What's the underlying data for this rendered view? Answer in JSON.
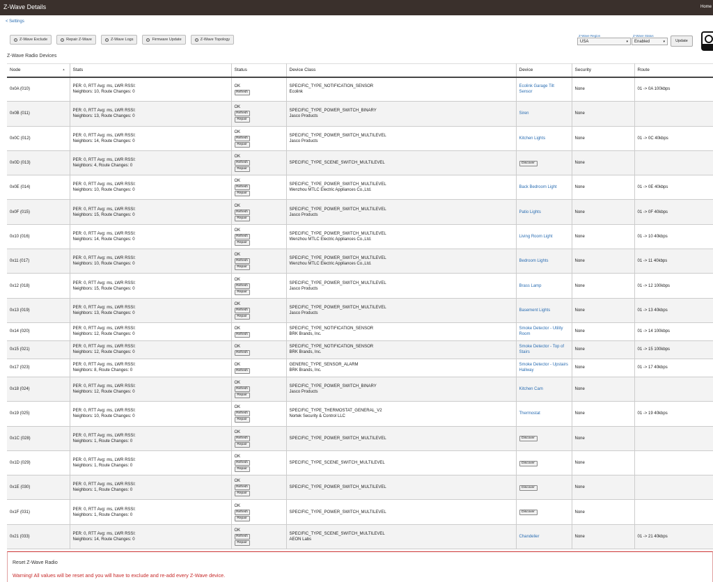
{
  "header": {
    "title": "Z-Wave Details",
    "home_label": "Home"
  },
  "breadcrumb": {
    "label": "< Settings"
  },
  "toolbar": {
    "buttons": [
      {
        "label": "Z-Wave Exclude",
        "icon": "zwave-icon"
      },
      {
        "label": "Repair Z-Wave",
        "icon": "zwave-icon"
      },
      {
        "label": "Z-Wave Logs",
        "icon": "list-icon"
      },
      {
        "label": "Firmware Update",
        "icon": "zwave-icon"
      },
      {
        "label": "Z-Wave Topology",
        "icon": "zwave-icon"
      }
    ]
  },
  "region": {
    "label": "Z-Wave Region",
    "value": "USA"
  },
  "status": {
    "label": "Z-Wave Status",
    "value": "Enabled"
  },
  "update_label": "Update",
  "section_title": "Z-Wave Radio Devices",
  "columns": [
    "Node",
    "Stats",
    "Status",
    "Device Class",
    "Device",
    "Security",
    "Route"
  ],
  "rows": [
    {
      "node": "0x0A (010)",
      "stats1": "PER: 0, RTT Avg: ms, LWR RSSI:",
      "stats2": "Neighbors: 10, Route Changes: 0",
      "status": "OK",
      "buttons": [
        "Refresh"
      ],
      "class1": "SPECIFIC_TYPE_NOTIFICATION_SENSOR",
      "class2": "Ecolink",
      "device": "Ecolink Garage Tilt Sensor",
      "security": "None",
      "route": "01 -> 0A 100kbps"
    },
    {
      "node": "0x0B (011)",
      "stats1": "PER: 0, RTT Avg: ms, LWR RSSI:",
      "stats2": "Neighbors: 13, Route Changes: 0",
      "status": "OK",
      "buttons": [
        "Refresh",
        "Repair"
      ],
      "class1": "SPECIFIC_TYPE_POWER_SWITCH_BINARY",
      "class2": "Jasco Products",
      "device": "Siren",
      "security": "None",
      "route": ""
    },
    {
      "node": "0x0C (012)",
      "stats1": "PER: 0, RTT Avg: ms, LWR RSSI:",
      "stats2": "Neighbors: 14, Route Changes: 0",
      "status": "OK",
      "buttons": [
        "Refresh",
        "Repair"
      ],
      "class1": "SPECIFIC_TYPE_POWER_SWITCH_MULTILEVEL",
      "class2": "Jasco Products",
      "device": "Kitchen Lights",
      "security": "None",
      "route": "01 -> 0C 40kbps"
    },
    {
      "node": "0x0D (013)",
      "stats1": "PER: 0, RTT Avg: ms, LWR RSSI:",
      "stats2": "Neighbors: 4, Route Changes: 0",
      "status": "OK",
      "buttons": [
        "Refresh",
        "Repair"
      ],
      "class1": "SPECIFIC_TYPE_SCENE_SWITCH_MULTILEVEL",
      "class2": "",
      "device": "",
      "discover": "Discover",
      "security": "None",
      "route": ""
    },
    {
      "node": "0x0E (014)",
      "stats1": "PER: 0, RTT Avg: ms, LWR RSSI:",
      "stats2": "Neighbors: 10, Route Changes: 0",
      "status": "OK",
      "buttons": [
        "Refresh",
        "Repair"
      ],
      "class1": "SPECIFIC_TYPE_POWER_SWITCH_MULTILEVEL",
      "class2": "Wenzhou MTLC Electric Appliances Co.,Ltd.",
      "device": "Back Bedroom Light",
      "security": "None",
      "route": "01 -> 0E 40kbps"
    },
    {
      "node": "0x0F (015)",
      "stats1": "PER: 0, RTT Avg: ms, LWR RSSI:",
      "stats2": "Neighbors: 15, Route Changes: 0",
      "status": "OK",
      "buttons": [
        "Refresh",
        "Repair"
      ],
      "class1": "SPECIFIC_TYPE_POWER_SWITCH_MULTILEVEL",
      "class2": "Jasco Products",
      "device": "Patio Lights",
      "security": "None",
      "route": "01 -> 0F 40kbps"
    },
    {
      "node": "0x10 (016)",
      "stats1": "PER: 0, RTT Avg: ms, LWR RSSI:",
      "stats2": "Neighbors: 14, Route Changes: 0",
      "status": "OK",
      "buttons": [
        "Refresh",
        "Repair"
      ],
      "class1": "SPECIFIC_TYPE_POWER_SWITCH_MULTILEVEL",
      "class2": "Wenzhou MTLC Electric Appliances Co.,Ltd.",
      "device": "Living Room Light",
      "security": "None",
      "route": "01 -> 10 40kbps"
    },
    {
      "node": "0x11 (017)",
      "stats1": "PER: 0, RTT Avg: ms, LWR RSSI:",
      "stats2": "Neighbors: 10, Route Changes: 0",
      "status": "OK",
      "buttons": [
        "Refresh",
        "Repair"
      ],
      "class1": "SPECIFIC_TYPE_POWER_SWITCH_MULTILEVEL",
      "class2": "Wenzhou MTLC Electric Appliances Co.,Ltd.",
      "device": "Bedroom Lights",
      "security": "None",
      "route": "01 -> 11 40kbps"
    },
    {
      "node": "0x12 (018)",
      "stats1": "PER: 0, RTT Avg: ms, LWR RSSI:",
      "stats2": "Neighbors: 15, Route Changes: 0",
      "status": "OK",
      "buttons": [
        "Refresh",
        "Repair"
      ],
      "class1": "SPECIFIC_TYPE_POWER_SWITCH_MULTILEVEL",
      "class2": "Jasco Products",
      "device": "Brass Lamp",
      "security": "None",
      "route": "01 -> 12 100kbps"
    },
    {
      "node": "0x13 (019)",
      "stats1": "PER: 0, RTT Avg: ms, LWR RSSI:",
      "stats2": "Neighbors: 13, Route Changes: 0",
      "status": "OK",
      "buttons": [
        "Refresh",
        "Repair"
      ],
      "class1": "SPECIFIC_TYPE_POWER_SWITCH_MULTILEVEL",
      "class2": "Jasco Products",
      "device": "Basement Lights",
      "security": "None",
      "route": "01 -> 13 40kbps"
    },
    {
      "node": "0x14 (020)",
      "short": true,
      "stats1": "PER: 0, RTT Avg: ms, LWR RSSI:",
      "stats2": "Neighbors: 12, Route Changes: 0",
      "status": "OK",
      "buttons": [
        "Refresh"
      ],
      "class1": "SPECIFIC_TYPE_NOTIFICATION_SENSOR",
      "class2": "BRK Brands, Inc.",
      "device": "Smoke Detector - Utility Room",
      "security": "None",
      "route": "01 -> 14 100kbps"
    },
    {
      "node": "0x15 (021)",
      "short": true,
      "stats1": "PER: 0, RTT Avg: ms, LWR RSSI:",
      "stats2": "Neighbors: 12, Route Changes: 0",
      "status": "OK",
      "buttons": [
        "Refresh"
      ],
      "class1": "SPECIFIC_TYPE_NOTIFICATION_SENSOR",
      "class2": "BRK Brands, Inc.",
      "device": "Smoke Detector - Top of Stairs",
      "security": "None",
      "route": "01 -> 15 100kbps"
    },
    {
      "node": "0x17 (023)",
      "short": true,
      "stats1": "PER: 0, RTT Avg: ms, LWR RSSI:",
      "stats2": "Neighbors: 8, Route Changes: 0",
      "status": "OK",
      "buttons": [
        "Refresh"
      ],
      "class1": "GENERIC_TYPE_SENSOR_ALARM",
      "class2": "BRK Brands, Inc.",
      "device": "Smoke Detector - Upstairs Hallway",
      "security": "None",
      "route": "01 -> 17 40kbps"
    },
    {
      "node": "0x18 (024)",
      "stats1": "PER: 0, RTT Avg: ms, LWR RSSI:",
      "stats2": "Neighbors: 12, Route Changes: 0",
      "status": "OK",
      "buttons": [
        "Refresh",
        "Repair"
      ],
      "class1": "SPECIFIC_TYPE_POWER_SWITCH_BINARY",
      "class2": "Jasco Products",
      "device": "Kitchen Cam",
      "security": "None",
      "route": ""
    },
    {
      "node": "0x19 (025)",
      "stats1": "PER: 0, RTT Avg: ms, LWR RSSI:",
      "stats2": "Neighbors: 10, Route Changes: 0",
      "status": "OK",
      "buttons": [
        "Refresh",
        "Repair"
      ],
      "class1": "SPECIFIC_TYPE_THERMOSTAT_GENERAL_V2",
      "class2": "Nortek Security & Control LLC",
      "device": "Thermostat",
      "security": "None",
      "route": "01 -> 19 40kbps"
    },
    {
      "node": "0x1C (028)",
      "stats1": "PER: 0, RTT Avg: ms, LWR RSSI:",
      "stats2": "Neighbors: 1, Route Changes: 0",
      "status": "OK",
      "buttons": [
        "Refresh",
        "Repair"
      ],
      "class1": "SPECIFIC_TYPE_POWER_SWITCH_MULTILEVEL",
      "class2": "",
      "device": "",
      "discover": "Discover",
      "security": "None",
      "route": ""
    },
    {
      "node": "0x1D (029)",
      "stats1": "PER: 0, RTT Avg: ms, LWR RSSI:",
      "stats2": "Neighbors: 1, Route Changes: 0",
      "status": "OK",
      "buttons": [
        "Refresh",
        "Repair"
      ],
      "class1": "SPECIFIC_TYPE_SCENE_SWITCH_MULTILEVEL",
      "class2": "",
      "device": "",
      "discover": "Discover",
      "security": "None",
      "route": ""
    },
    {
      "node": "0x1E (030)",
      "stats1": "PER: 0, RTT Avg: ms, LWR RSSI:",
      "stats2": "Neighbors: 1, Route Changes: 0",
      "status": "OK",
      "buttons": [
        "Refresh",
        "Repair"
      ],
      "class1": "SPECIFIC_TYPE_POWER_SWITCH_MULTILEVEL",
      "class2": "",
      "device": "",
      "discover": "Discover",
      "security": "None",
      "route": ""
    },
    {
      "node": "0x1F (031)",
      "stats1": "PER: 0, RTT Avg: ms, LWR RSSI:",
      "stats2": "Neighbors: 1, Route Changes: 0",
      "status": "OK",
      "buttons": [
        "Refresh",
        "Repair"
      ],
      "class1": "SPECIFIC_TYPE_POWER_SWITCH_MULTILEVEL",
      "class2": "",
      "device": "",
      "discover": "Discover",
      "security": "None",
      "route": ""
    },
    {
      "node": "0x21 (033)",
      "stats1": "PER: 0, RTT Avg: ms, LWR RSSI:",
      "stats2": "Neighbors: 14, Route Changes: 0",
      "status": "OK",
      "buttons": [
        "Refresh",
        "Repair"
      ],
      "class1": "SPECIFIC_TYPE_SCENE_SWITCH_MULTILEVEL",
      "class2": "AEON Labs",
      "device": "Chandelier",
      "security": "None",
      "route": "01 -> 21 40kbps"
    }
  ],
  "reset": {
    "title": "Reset Z-Wave Radio",
    "warning": "Warning! All values will be reset and you will have to exclude and re-add every Z-Wave device."
  }
}
